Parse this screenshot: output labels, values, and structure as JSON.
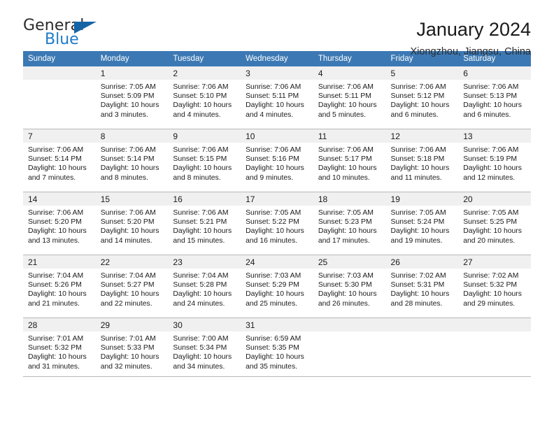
{
  "brand": {
    "name_part1": "General",
    "name_part2": "Blue",
    "triangle_color": "#1464a5",
    "blue_color": "#1e7bc8"
  },
  "header": {
    "title": "January 2024",
    "subtitle": "Xiongzhou, Jiangsu, China"
  },
  "theme": {
    "header_row_bg": "#3c79b4",
    "daynum_bg": "#f0f0f0",
    "grid_line": "#b9b9b9"
  },
  "weekday_headers": [
    "Sunday",
    "Monday",
    "Tuesday",
    "Wednesday",
    "Thursday",
    "Friday",
    "Saturday"
  ],
  "weeks": [
    [
      {
        "day": "",
        "sunrise": "",
        "sunset": "",
        "daylight_line1": "",
        "daylight_line2": ""
      },
      {
        "day": "1",
        "sunrise": "Sunrise: 7:05 AM",
        "sunset": "Sunset: 5:09 PM",
        "daylight_line1": "Daylight: 10 hours",
        "daylight_line2": "and 3 minutes."
      },
      {
        "day": "2",
        "sunrise": "Sunrise: 7:06 AM",
        "sunset": "Sunset: 5:10 PM",
        "daylight_line1": "Daylight: 10 hours",
        "daylight_line2": "and 4 minutes."
      },
      {
        "day": "3",
        "sunrise": "Sunrise: 7:06 AM",
        "sunset": "Sunset: 5:11 PM",
        "daylight_line1": "Daylight: 10 hours",
        "daylight_line2": "and 4 minutes."
      },
      {
        "day": "4",
        "sunrise": "Sunrise: 7:06 AM",
        "sunset": "Sunset: 5:11 PM",
        "daylight_line1": "Daylight: 10 hours",
        "daylight_line2": "and 5 minutes."
      },
      {
        "day": "5",
        "sunrise": "Sunrise: 7:06 AM",
        "sunset": "Sunset: 5:12 PM",
        "daylight_line1": "Daylight: 10 hours",
        "daylight_line2": "and 6 minutes."
      },
      {
        "day": "6",
        "sunrise": "Sunrise: 7:06 AM",
        "sunset": "Sunset: 5:13 PM",
        "daylight_line1": "Daylight: 10 hours",
        "daylight_line2": "and 6 minutes."
      }
    ],
    [
      {
        "day": "7",
        "sunrise": "Sunrise: 7:06 AM",
        "sunset": "Sunset: 5:14 PM",
        "daylight_line1": "Daylight: 10 hours",
        "daylight_line2": "and 7 minutes."
      },
      {
        "day": "8",
        "sunrise": "Sunrise: 7:06 AM",
        "sunset": "Sunset: 5:14 PM",
        "daylight_line1": "Daylight: 10 hours",
        "daylight_line2": "and 8 minutes."
      },
      {
        "day": "9",
        "sunrise": "Sunrise: 7:06 AM",
        "sunset": "Sunset: 5:15 PM",
        "daylight_line1": "Daylight: 10 hours",
        "daylight_line2": "and 8 minutes."
      },
      {
        "day": "10",
        "sunrise": "Sunrise: 7:06 AM",
        "sunset": "Sunset: 5:16 PM",
        "daylight_line1": "Daylight: 10 hours",
        "daylight_line2": "and 9 minutes."
      },
      {
        "day": "11",
        "sunrise": "Sunrise: 7:06 AM",
        "sunset": "Sunset: 5:17 PM",
        "daylight_line1": "Daylight: 10 hours",
        "daylight_line2": "and 10 minutes."
      },
      {
        "day": "12",
        "sunrise": "Sunrise: 7:06 AM",
        "sunset": "Sunset: 5:18 PM",
        "daylight_line1": "Daylight: 10 hours",
        "daylight_line2": "and 11 minutes."
      },
      {
        "day": "13",
        "sunrise": "Sunrise: 7:06 AM",
        "sunset": "Sunset: 5:19 PM",
        "daylight_line1": "Daylight: 10 hours",
        "daylight_line2": "and 12 minutes."
      }
    ],
    [
      {
        "day": "14",
        "sunrise": "Sunrise: 7:06 AM",
        "sunset": "Sunset: 5:20 PM",
        "daylight_line1": "Daylight: 10 hours",
        "daylight_line2": "and 13 minutes."
      },
      {
        "day": "15",
        "sunrise": "Sunrise: 7:06 AM",
        "sunset": "Sunset: 5:20 PM",
        "daylight_line1": "Daylight: 10 hours",
        "daylight_line2": "and 14 minutes."
      },
      {
        "day": "16",
        "sunrise": "Sunrise: 7:06 AM",
        "sunset": "Sunset: 5:21 PM",
        "daylight_line1": "Daylight: 10 hours",
        "daylight_line2": "and 15 minutes."
      },
      {
        "day": "17",
        "sunrise": "Sunrise: 7:05 AM",
        "sunset": "Sunset: 5:22 PM",
        "daylight_line1": "Daylight: 10 hours",
        "daylight_line2": "and 16 minutes."
      },
      {
        "day": "18",
        "sunrise": "Sunrise: 7:05 AM",
        "sunset": "Sunset: 5:23 PM",
        "daylight_line1": "Daylight: 10 hours",
        "daylight_line2": "and 17 minutes."
      },
      {
        "day": "19",
        "sunrise": "Sunrise: 7:05 AM",
        "sunset": "Sunset: 5:24 PM",
        "daylight_line1": "Daylight: 10 hours",
        "daylight_line2": "and 19 minutes."
      },
      {
        "day": "20",
        "sunrise": "Sunrise: 7:05 AM",
        "sunset": "Sunset: 5:25 PM",
        "daylight_line1": "Daylight: 10 hours",
        "daylight_line2": "and 20 minutes."
      }
    ],
    [
      {
        "day": "21",
        "sunrise": "Sunrise: 7:04 AM",
        "sunset": "Sunset: 5:26 PM",
        "daylight_line1": "Daylight: 10 hours",
        "daylight_line2": "and 21 minutes."
      },
      {
        "day": "22",
        "sunrise": "Sunrise: 7:04 AM",
        "sunset": "Sunset: 5:27 PM",
        "daylight_line1": "Daylight: 10 hours",
        "daylight_line2": "and 22 minutes."
      },
      {
        "day": "23",
        "sunrise": "Sunrise: 7:04 AM",
        "sunset": "Sunset: 5:28 PM",
        "daylight_line1": "Daylight: 10 hours",
        "daylight_line2": "and 24 minutes."
      },
      {
        "day": "24",
        "sunrise": "Sunrise: 7:03 AM",
        "sunset": "Sunset: 5:29 PM",
        "daylight_line1": "Daylight: 10 hours",
        "daylight_line2": "and 25 minutes."
      },
      {
        "day": "25",
        "sunrise": "Sunrise: 7:03 AM",
        "sunset": "Sunset: 5:30 PM",
        "daylight_line1": "Daylight: 10 hours",
        "daylight_line2": "and 26 minutes."
      },
      {
        "day": "26",
        "sunrise": "Sunrise: 7:02 AM",
        "sunset": "Sunset: 5:31 PM",
        "daylight_line1": "Daylight: 10 hours",
        "daylight_line2": "and 28 minutes."
      },
      {
        "day": "27",
        "sunrise": "Sunrise: 7:02 AM",
        "sunset": "Sunset: 5:32 PM",
        "daylight_line1": "Daylight: 10 hours",
        "daylight_line2": "and 29 minutes."
      }
    ],
    [
      {
        "day": "28",
        "sunrise": "Sunrise: 7:01 AM",
        "sunset": "Sunset: 5:32 PM",
        "daylight_line1": "Daylight: 10 hours",
        "daylight_line2": "and 31 minutes."
      },
      {
        "day": "29",
        "sunrise": "Sunrise: 7:01 AM",
        "sunset": "Sunset: 5:33 PM",
        "daylight_line1": "Daylight: 10 hours",
        "daylight_line2": "and 32 minutes."
      },
      {
        "day": "30",
        "sunrise": "Sunrise: 7:00 AM",
        "sunset": "Sunset: 5:34 PM",
        "daylight_line1": "Daylight: 10 hours",
        "daylight_line2": "and 34 minutes."
      },
      {
        "day": "31",
        "sunrise": "Sunrise: 6:59 AM",
        "sunset": "Sunset: 5:35 PM",
        "daylight_line1": "Daylight: 10 hours",
        "daylight_line2": "and 35 minutes."
      },
      {
        "day": "",
        "sunrise": "",
        "sunset": "",
        "daylight_line1": "",
        "daylight_line2": ""
      },
      {
        "day": "",
        "sunrise": "",
        "sunset": "",
        "daylight_line1": "",
        "daylight_line2": ""
      },
      {
        "day": "",
        "sunrise": "",
        "sunset": "",
        "daylight_line1": "",
        "daylight_line2": ""
      }
    ]
  ]
}
